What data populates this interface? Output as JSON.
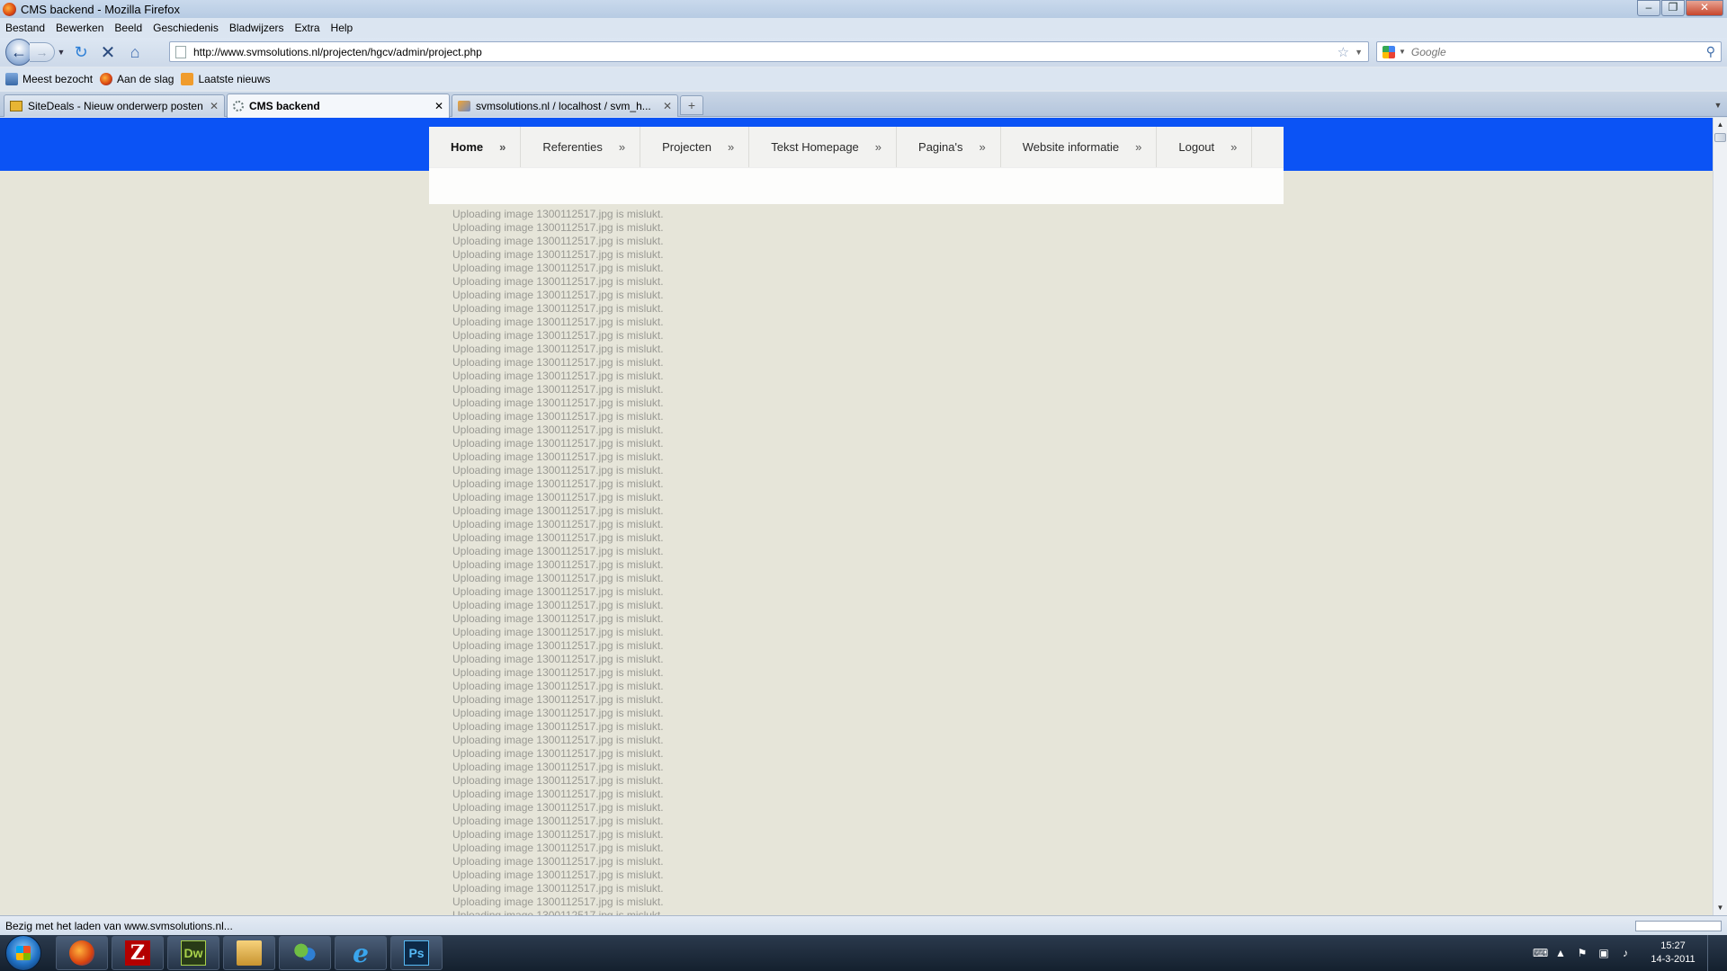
{
  "window": {
    "title": "CMS backend - Mozilla Firefox",
    "minimize": "–",
    "maximize": "❐",
    "close": "✕"
  },
  "menu": [
    "Bestand",
    "Bewerken",
    "Beeld",
    "Geschiedenis",
    "Bladwijzers",
    "Extra",
    "Help"
  ],
  "navbar": {
    "url": "http://www.svmsolutions.nl/projecten/hgcv/admin/project.php",
    "search_placeholder": "Google"
  },
  "bookmarks": [
    "Meest bezocht",
    "Aan de slag",
    "Laatste nieuws"
  ],
  "tabs": [
    {
      "label": "SiteDeals - Nieuw onderwerp posten",
      "active": false
    },
    {
      "label": "CMS backend",
      "active": true
    },
    {
      "label": "svmsolutions.nl / localhost / svm_h...",
      "active": false
    }
  ],
  "page": {
    "nav": [
      "Home",
      "Referenties",
      "Projecten",
      "Tekst Homepage",
      "Pagina's",
      "Website informatie",
      "Logout"
    ],
    "nav_separator": "»",
    "message": "Uploading image 1300112517.jpg is mislukt.",
    "message_count": 53
  },
  "status": {
    "text": "Bezig met het laden van www.svmsolutions.nl...",
    "progress": 0.0
  },
  "taskbar": {
    "apps": [
      "firefox",
      "filezilla",
      "dreamweaver",
      "explorer",
      "messenger",
      "internet-explorer",
      "photoshop"
    ],
    "filezilla_glyph": "Z",
    "dw_glyph": "Dw",
    "ie_glyph": "e",
    "ps_glyph": "Ps",
    "time": "15:27",
    "date": "14-3-2011"
  }
}
